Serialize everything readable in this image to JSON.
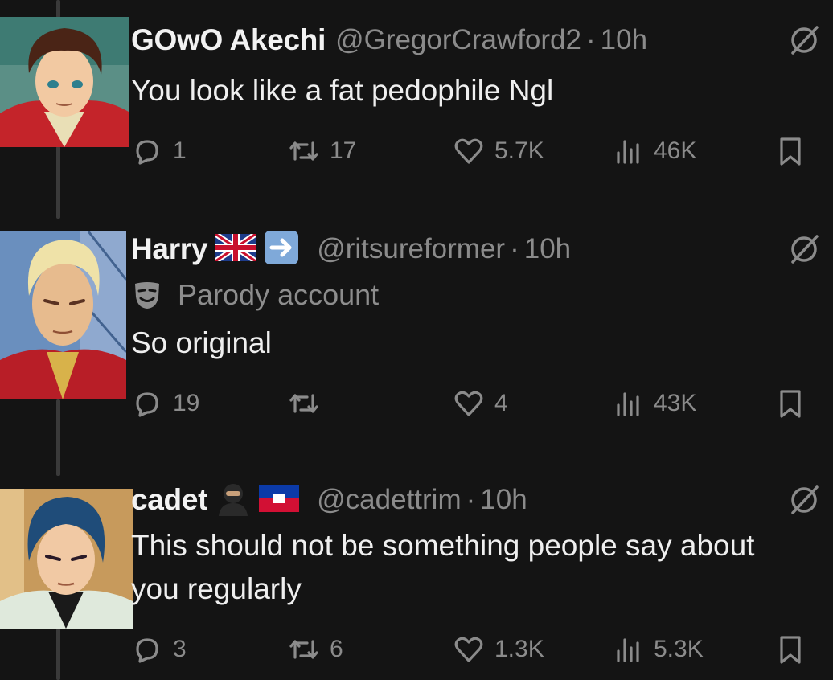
{
  "colors": {
    "background": "#141414",
    "muted_text": "#8b8b8b",
    "primary_text": "#efefef",
    "thread_line": "#3a3a3a"
  },
  "tweets": [
    {
      "display_name": "GOwO Akechi",
      "handle": "@GregorCrawford2",
      "separator": "·",
      "time": "10h",
      "text": "You look like a fat pedophile Ngl",
      "stats": {
        "replies": "1",
        "reposts": "17",
        "likes": "5.7K",
        "views": "46K"
      }
    },
    {
      "display_name": "Harry",
      "badges": [
        "uk-flag-emoji",
        "right-arrow-emoji"
      ],
      "handle": "@ritsureformer",
      "separator": "·",
      "time": "10h",
      "label": "Parody account",
      "text": "So original",
      "stats": {
        "replies": "19",
        "reposts": "",
        "likes": "4",
        "views": "43K"
      }
    },
    {
      "display_name": "cadet",
      "badges": [
        "ninja-emoji",
        "haiti-flag-emoji"
      ],
      "handle": "@cadettrim",
      "separator": "·",
      "time": "10h",
      "text": "This should not be something people say about you regularly",
      "stats": {
        "replies": "3",
        "reposts": "6",
        "likes": "1.3K",
        "views": "5.3K"
      }
    }
  ]
}
